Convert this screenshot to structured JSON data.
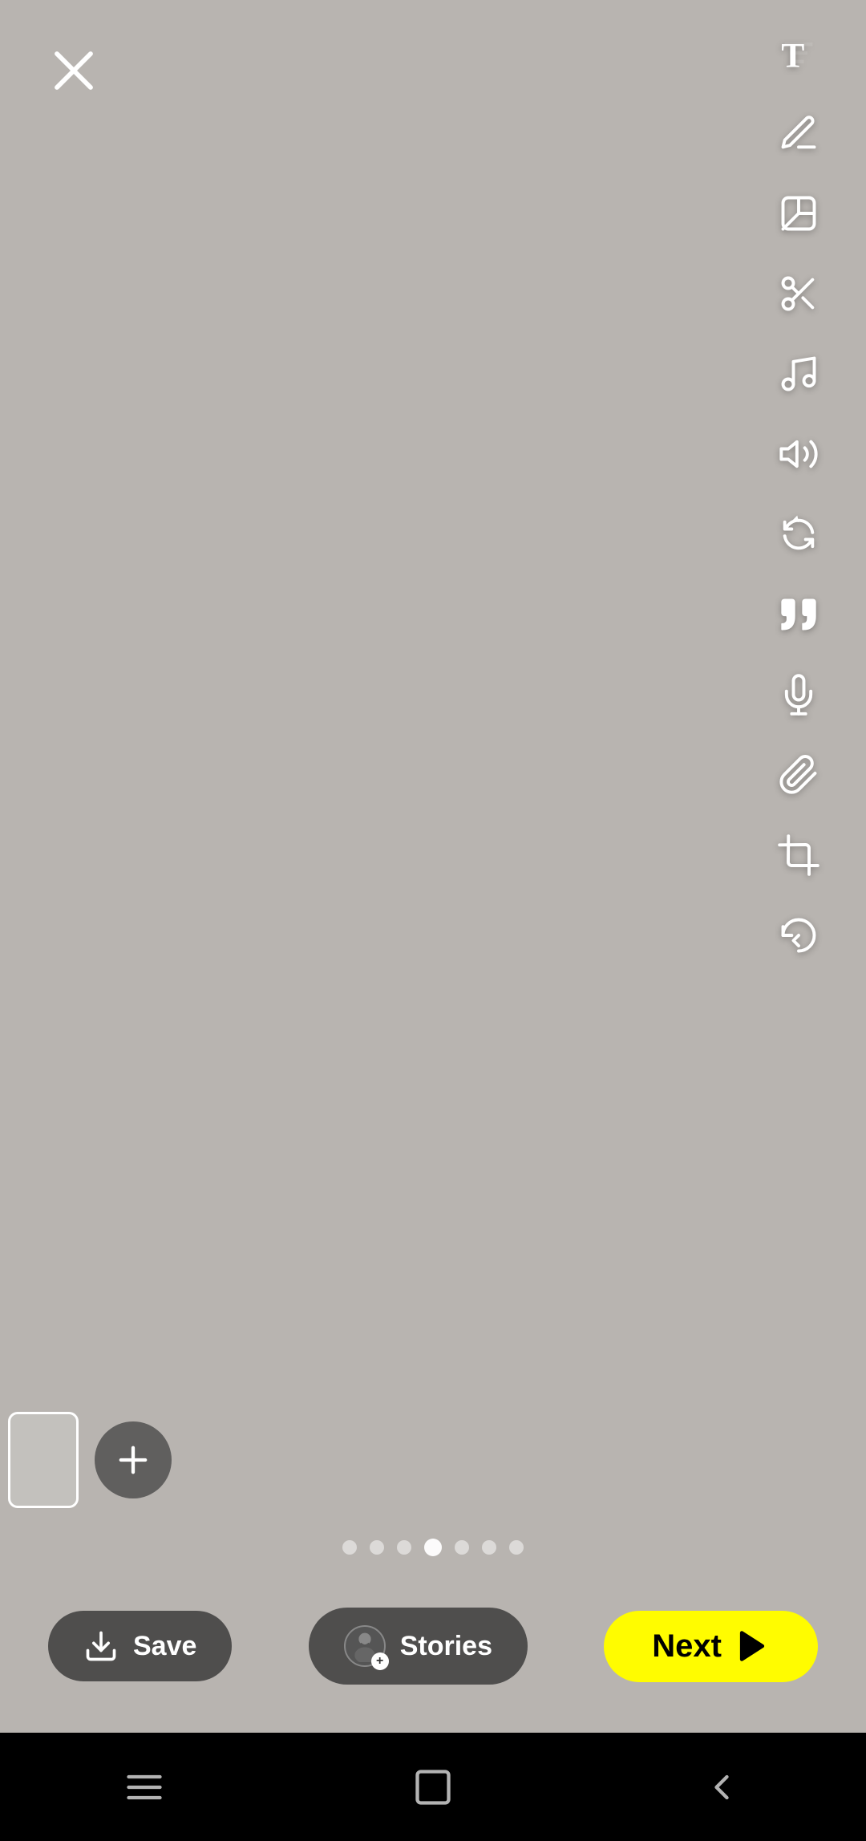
{
  "canvas": {
    "background_color": "#b8b4b0"
  },
  "toolbar": {
    "close_label": "×",
    "icons": [
      {
        "name": "text-icon",
        "label": "T",
        "semantic": "text"
      },
      {
        "name": "draw-icon",
        "label": "✏",
        "semantic": "draw"
      },
      {
        "name": "sticker-icon",
        "label": "sticker",
        "semantic": "sticker"
      },
      {
        "name": "scissors-icon",
        "label": "✂",
        "semantic": "scissors"
      },
      {
        "name": "music-icon",
        "label": "♪",
        "semantic": "music"
      },
      {
        "name": "volume-icon",
        "label": "🔊",
        "semantic": "volume"
      },
      {
        "name": "remix-icon",
        "label": "remix",
        "semantic": "remix"
      },
      {
        "name": "quote-icon",
        "label": "\"\"",
        "semantic": "quote"
      },
      {
        "name": "mic-icon",
        "label": "mic",
        "semantic": "microphone"
      },
      {
        "name": "link-icon",
        "label": "link",
        "semantic": "link"
      },
      {
        "name": "crop-icon",
        "label": "crop",
        "semantic": "crop"
      },
      {
        "name": "undo-icon",
        "label": "undo",
        "semantic": "undo"
      }
    ]
  },
  "page_dots": {
    "count": 7,
    "active_index": 3
  },
  "bottom_bar": {
    "save_label": "Save",
    "stories_label": "Stories",
    "next_label": "Next"
  },
  "nav_bar": {
    "menu_icon": "menu",
    "home_icon": "home",
    "back_icon": "back"
  }
}
